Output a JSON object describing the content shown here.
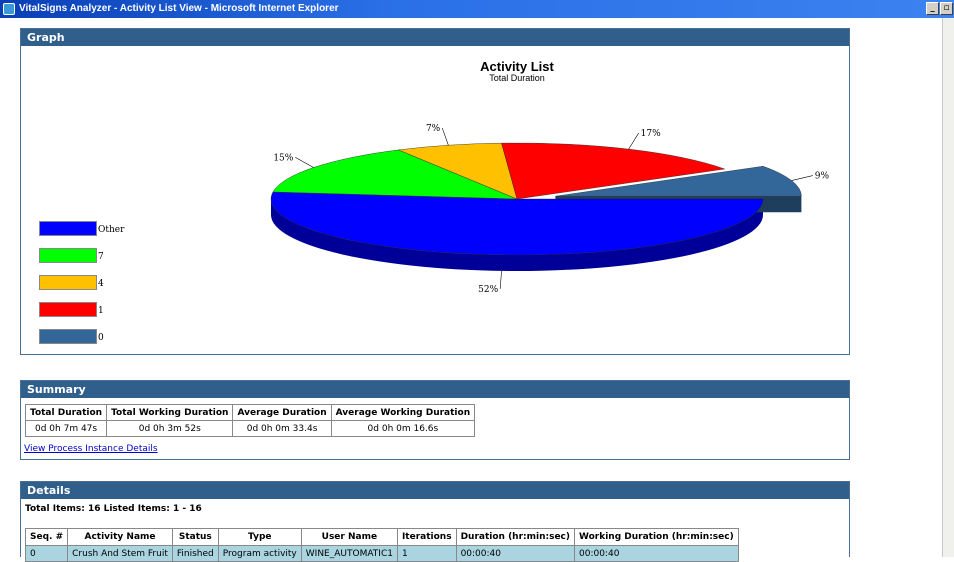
{
  "window": {
    "title": "VitalSigns Analyzer - Activity List View - Microsoft Internet Explorer",
    "minimize": "_",
    "maximize": "▫"
  },
  "graph": {
    "header": "Graph",
    "legend": [
      {
        "label": "Other",
        "color": "#0000ff"
      },
      {
        "label": "7",
        "color": "#00ff00"
      },
      {
        "label": "4",
        "color": "#ffc000"
      },
      {
        "label": "1",
        "color": "#ff0000"
      },
      {
        "label": "0",
        "color": "#336699"
      }
    ]
  },
  "chart_data": {
    "type": "pie",
    "title": "Activity List",
    "subtitle": "Total Duration",
    "slices": [
      {
        "label": "Other",
        "value": 52,
        "display": "52%",
        "color": "#0000ff"
      },
      {
        "label": "7",
        "value": 15,
        "display": "15%",
        "color": "#00ff00"
      },
      {
        "label": "4",
        "value": 7,
        "display": "7%",
        "color": "#ffc000"
      },
      {
        "label": "1",
        "value": 17,
        "display": "17%",
        "color": "#ff0000"
      },
      {
        "label": "0",
        "value": 9,
        "display": "9%",
        "color": "#336699",
        "exploded": true
      }
    ]
  },
  "summary": {
    "header": "Summary",
    "columns": [
      "Total Duration",
      "Total Working Duration",
      "Average Duration",
      "Average Working Duration"
    ],
    "values": [
      "0d 0h 7m 47s",
      "0d 0h 3m 52s",
      "0d 0h 0m 33.4s",
      "0d 0h 0m 16.6s"
    ],
    "link": "View Process Instance Details"
  },
  "details": {
    "header": "Details",
    "totals": "Total Items: 16   Listed Items: 1 - 16",
    "columns": [
      "Seq. #",
      "Activity Name",
      "Status",
      "Type",
      "User Name",
      "Iterations",
      "Duration (hr:min:sec)",
      "Working Duration (hr:min:sec)"
    ],
    "rows": [
      [
        "0",
        "Crush And Stem Fruit",
        "Finished",
        "Program activity",
        "WINE_AUTOMATIC1",
        "1",
        "00:00:40",
        "00:00:40"
      ]
    ]
  }
}
